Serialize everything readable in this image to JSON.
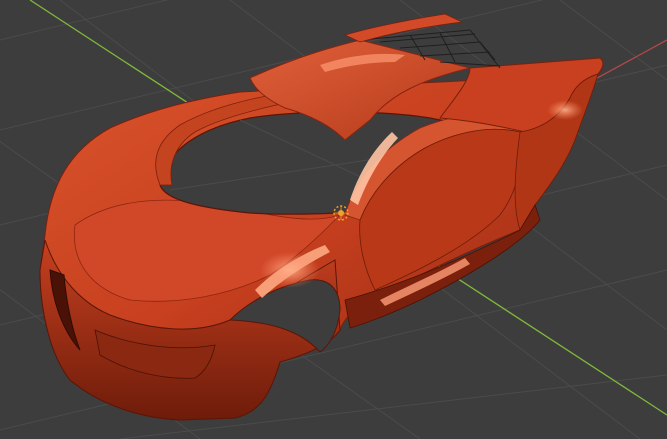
{
  "viewport": {
    "name": "3D viewport",
    "background": "#3d3d3d",
    "grid_color": "#4a4a4a",
    "x_axis_color": "#b04848",
    "y_axis_color": "#7fb83a"
  },
  "object": {
    "name": "car-body-mesh",
    "base_color": "#c8401f",
    "highlight_color": "#ff8c66",
    "shadow_color": "#5a1608"
  },
  "origin_marker": {
    "icon": "object-origin-icon",
    "color": "#f0a030"
  }
}
